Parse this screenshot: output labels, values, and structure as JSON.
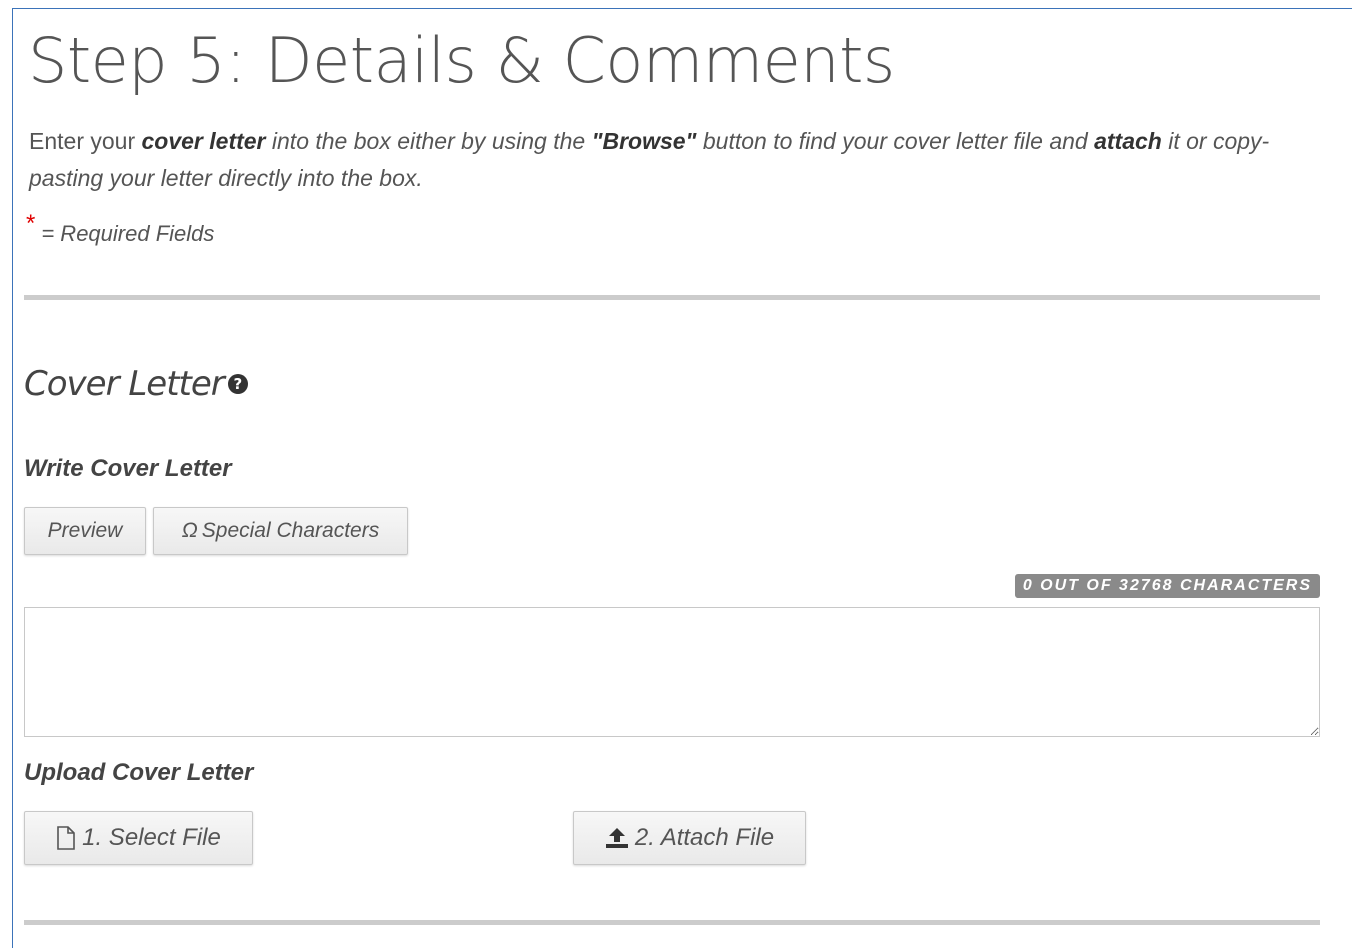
{
  "page": {
    "title": "Step 5: Details & Comments",
    "intro": {
      "t1": "Enter your ",
      "b1": "cover letter",
      "t2": " into the box either by using the ",
      "b2": "\"Browse\"",
      "t3": " button to find your cover letter file and ",
      "b3": "attach",
      "t4": " it or copy-pasting your letter directly into the box."
    },
    "required": {
      "star": "*",
      "label": "= Required Fields"
    }
  },
  "cover_letter": {
    "title": "Cover Letter",
    "help_icon": "question-circle-icon",
    "write": {
      "heading": "Write Cover Letter",
      "preview_label": "Preview",
      "special_symbol": "Ω",
      "special_label": "Special Characters",
      "char_count": "0 OUT OF 32768 CHARACTERS",
      "textarea_value": ""
    },
    "upload": {
      "heading": "Upload Cover Letter",
      "select_icon": "file-icon",
      "select_label": "1. Select File",
      "attach_icon": "upload-icon",
      "attach_label": "2. Attach File"
    }
  },
  "colors": {
    "frame_border": "#3b73b9",
    "required_star": "#e00000",
    "badge_bg": "#8a8a8a",
    "divider": "#cccccc"
  }
}
